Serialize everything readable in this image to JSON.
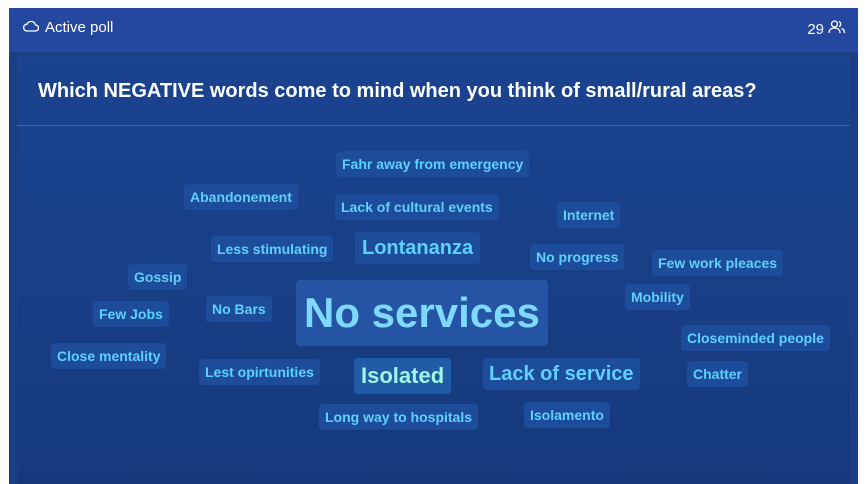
{
  "header": {
    "status_label": "Active poll",
    "status_icon": "cloud-icon",
    "participant_count": "29",
    "participants_icon": "people-icon"
  },
  "poll": {
    "question": "Which NEGATIVE words come to mind when you think of small/rural areas?"
  },
  "colors": {
    "word_text": "#5fd0ff",
    "word_highlight": "#9ff5e6",
    "word_bg": "#1d4d9a",
    "panel_bg": "#173d84",
    "topbar_bg": "#2448a0"
  },
  "words": [
    "Fahr away from emergency",
    "Abandonement",
    "Lack of cultural events",
    "Internet",
    "Less stimulating",
    "Lontananza",
    "No progress",
    "Few work pleaces",
    "Gossip",
    "Mobility",
    "Few Jobs",
    "No Bars",
    "No services",
    "Closeminded people",
    "Close mentality",
    "Lest opirtunities",
    "Isolated",
    "Lack of service",
    "Chatter",
    "Long way to hospitals",
    "Isolamento"
  ]
}
